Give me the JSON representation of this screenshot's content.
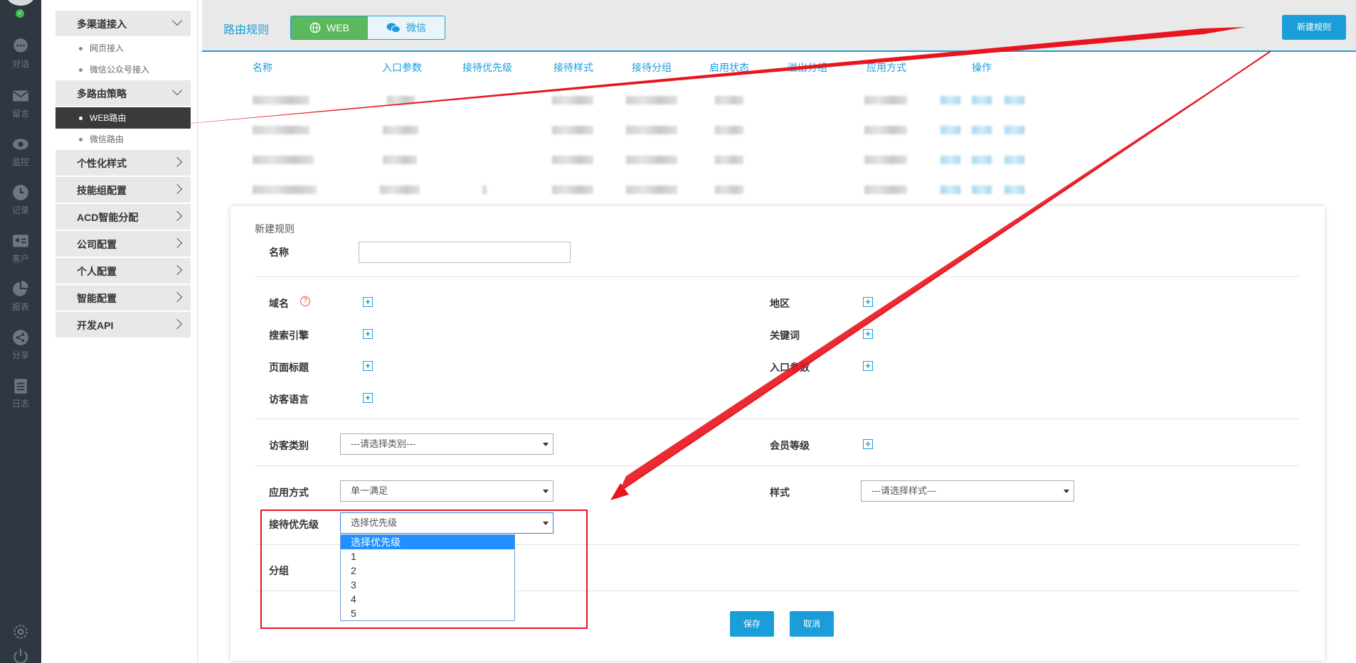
{
  "sidebar_rail": {
    "items": [
      {
        "icon": "chat-icon",
        "label": "对话"
      },
      {
        "icon": "mail-icon",
        "label": "留言"
      },
      {
        "icon": "eye-icon",
        "label": "监控"
      },
      {
        "icon": "clock-icon",
        "label": "记录"
      },
      {
        "icon": "contact-card-icon",
        "label": "客户"
      },
      {
        "icon": "pie-chart-icon",
        "label": "报表"
      },
      {
        "icon": "share-icon",
        "label": "分享"
      },
      {
        "icon": "clipboard-icon",
        "label": "日志"
      }
    ],
    "bottom_icons": [
      "gear-icon",
      "power-icon"
    ]
  },
  "menu": {
    "groups": [
      {
        "label": "多渠道接入",
        "expanded": true,
        "children": [
          "网页接入",
          "微信公众号接入"
        ]
      },
      {
        "label": "多路由策略",
        "expanded": true,
        "children": [
          "WEB路由",
          "微信路由"
        ],
        "active_child": "WEB路由"
      },
      {
        "label": "个性化样式"
      },
      {
        "label": "技能组配置"
      },
      {
        "label": "ACD智能分配"
      },
      {
        "label": "公司配置"
      },
      {
        "label": "个人配置"
      },
      {
        "label": "智能配置"
      },
      {
        "label": "开发API"
      }
    ]
  },
  "header": {
    "title": "路由规则",
    "tabs": [
      {
        "label": "WEB",
        "icon": "globe-icon",
        "active": true
      },
      {
        "label": "微信",
        "icon": "wechat-icon",
        "active": false
      }
    ],
    "new_rule_button": "新建规则"
  },
  "table": {
    "columns": [
      "名称",
      "入口参数",
      "接待优先级",
      "接待样式",
      "接待分组",
      "启用状态",
      "溢出分组",
      "应用方式",
      "操作"
    ],
    "row_count": 4
  },
  "form": {
    "title": "新建规则",
    "name_label": "名称",
    "name_value": "",
    "domain_label": "域名",
    "region_label": "地区",
    "search_engine_label": "搜索引擎",
    "keyword_label": "关键词",
    "page_title_label": "页面标题",
    "entry_param_label": "入口参数",
    "visitor_lang_label": "访客语言",
    "visitor_type_label": "访客类别",
    "visitor_type_value": "---请选择类别---",
    "member_level_label": "会员等级",
    "apply_mode_label": "应用方式",
    "apply_mode_value": "单一满足",
    "style_label": "样式",
    "style_value": "---请选择样式---",
    "priority_label": "接待优先级",
    "priority_value": "选择优先级",
    "priority_options": [
      "选择优先级",
      "1",
      "2",
      "3",
      "4",
      "5"
    ],
    "group_label": "分组",
    "save_button": "保存",
    "cancel_button": "取消"
  },
  "colors": {
    "accent": "#1a9dd9",
    "active_tab": "#5cb85c",
    "annotation": "#e8141e",
    "rail_bg": "#2f3840"
  }
}
